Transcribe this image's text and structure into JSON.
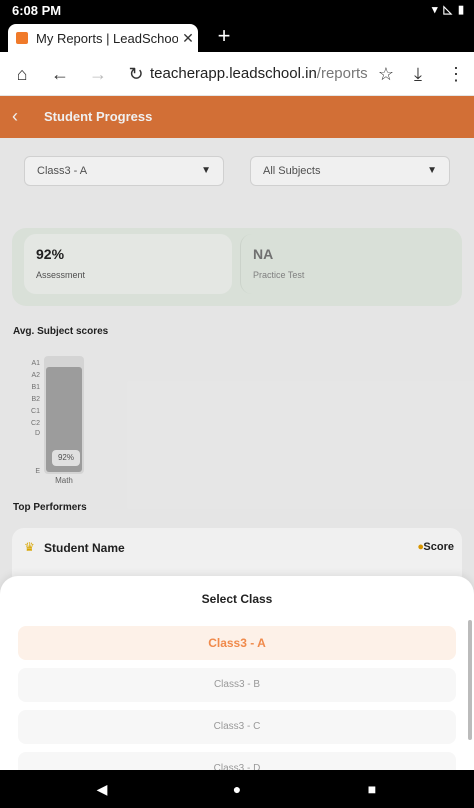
{
  "status": {
    "time": "6:08 PM",
    "icons": [
      "wifi-icon",
      "signal-off-icon",
      "battery-icon"
    ]
  },
  "browser": {
    "tab_title": "My Reports | LeadSchool",
    "url_host": "teacherapp.leadschool.in",
    "url_path": "/reports"
  },
  "app": {
    "header_title": "Student Progress",
    "class_select": "Class3 - A",
    "subject_select": "All Subjects",
    "stats": [
      {
        "value": "92%",
        "label": "Assessment"
      },
      {
        "value": "NA",
        "label": "Practice Test"
      }
    ],
    "avg_title": "Avg. Subject scores",
    "top_title": "Top Performers",
    "student_name_label": "Student Name",
    "score_label": "Score",
    "colors": {
      "accent": "#e0763a",
      "selected_text": "#f08a4b"
    }
  },
  "chart_data": {
    "type": "bar",
    "categories": [
      "Math"
    ],
    "values": [
      92
    ],
    "value_labels": [
      "92%"
    ],
    "y_ticks": [
      "A1",
      "A2",
      "B1",
      "B2",
      "C1",
      "C2",
      "D",
      "E"
    ],
    "ylim": [
      0,
      100
    ]
  },
  "sheet": {
    "title": "Select Class",
    "options": [
      "Class3 - A",
      "Class3 - B",
      "Class3 - C",
      "Class3 - D"
    ],
    "selected": 0
  }
}
